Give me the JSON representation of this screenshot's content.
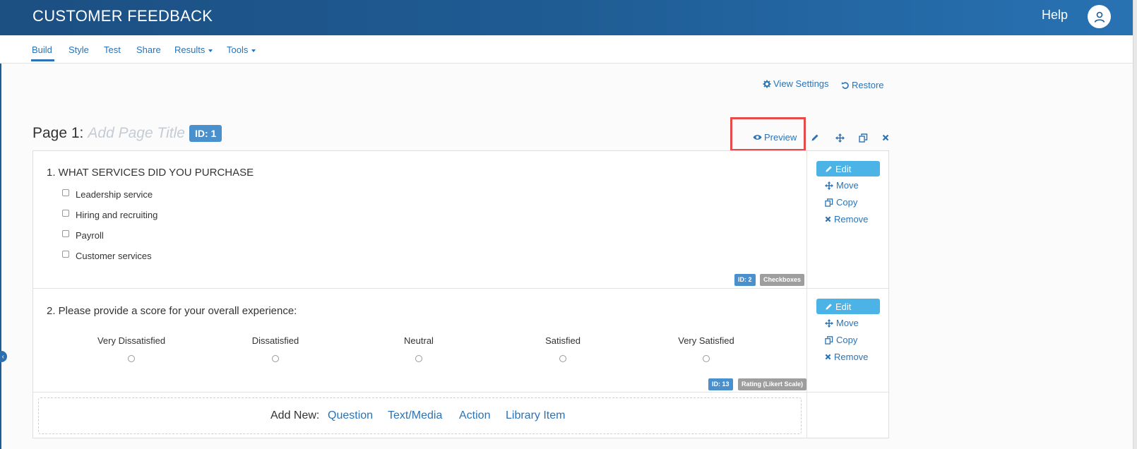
{
  "header": {
    "app_title": "CUSTOMER FEEDBACK",
    "help_label": "Help"
  },
  "nav": {
    "items": [
      {
        "label": "Build",
        "active": true
      },
      {
        "label": "Style"
      },
      {
        "label": "Test"
      },
      {
        "label": "Share"
      },
      {
        "label": "Results",
        "dropdown": true
      },
      {
        "label": "Tools",
        "dropdown": true
      }
    ]
  },
  "utility": {
    "view_settings": "View Settings",
    "restore": "Restore"
  },
  "page": {
    "prefix": "Page 1:",
    "title_placeholder": "Add Page Title",
    "id_badge": "ID: 1",
    "preview_label": "Preview"
  },
  "questions": [
    {
      "title": "1. WHAT SERVICES DID YOU PURCHASE",
      "options": [
        "Leadership service",
        "Hiring and recruiting",
        "Payroll",
        "Customer services"
      ],
      "id_badge": "ID: 2",
      "type_badge": "Checkboxes"
    },
    {
      "title": "2. Please provide a score for your overall experience:",
      "scale": [
        "Very Dissatisfied",
        "Dissatisfied",
        "Neutral",
        "Satisfied",
        "Very Satisfied"
      ],
      "id_badge": "ID: 13",
      "type_badge": "Rating (Likert Scale)"
    }
  ],
  "actions": {
    "edit": "Edit",
    "move": "Move",
    "copy": "Copy",
    "remove": "Remove"
  },
  "add_new": {
    "label": "Add New:",
    "links": [
      "Question",
      "Text/Media",
      "Action",
      "Library Item"
    ]
  },
  "colors": {
    "header_start": "#1c4f82",
    "header_end": "#2872b3",
    "link": "#2b73b5",
    "edit_button": "#4cb3e6",
    "highlight": "#e64b4b"
  }
}
